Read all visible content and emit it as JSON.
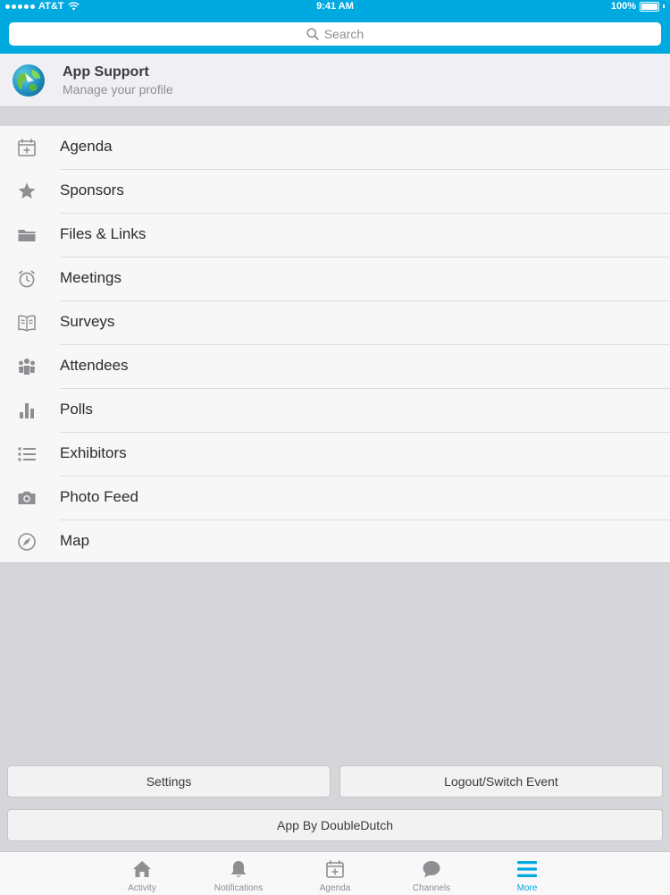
{
  "status_bar": {
    "carrier": "AT&T",
    "time": "9:41 AM",
    "battery": "100%"
  },
  "search": {
    "placeholder": "Search"
  },
  "profile": {
    "title": "App Support",
    "subtitle": "Manage your profile"
  },
  "menu": {
    "items": [
      {
        "label": "Agenda",
        "icon": "calendar-icon"
      },
      {
        "label": "Sponsors",
        "icon": "star-icon"
      },
      {
        "label": "Files & Links",
        "icon": "folder-icon"
      },
      {
        "label": "Meetings",
        "icon": "alarm-clock-icon"
      },
      {
        "label": "Surveys",
        "icon": "book-icon"
      },
      {
        "label": "Attendees",
        "icon": "people-icon"
      },
      {
        "label": "Polls",
        "icon": "bar-chart-icon"
      },
      {
        "label": "Exhibitors",
        "icon": "list-icon"
      },
      {
        "label": "Photo Feed",
        "icon": "camera-icon"
      },
      {
        "label": "Map",
        "icon": "compass-icon"
      }
    ]
  },
  "buttons": {
    "settings": "Settings",
    "logout": "Logout/Switch Event",
    "app_by": "App By DoubleDutch"
  },
  "tabs": [
    {
      "label": "Activity",
      "icon": "home-icon"
    },
    {
      "label": "Notifications",
      "icon": "bell-icon"
    },
    {
      "label": "Agenda",
      "icon": "calendar-icon"
    },
    {
      "label": "Channels",
      "icon": "chat-bubble-icon"
    },
    {
      "label": "More",
      "icon": "hamburger-menu-icon",
      "active": true
    }
  ],
  "colors": {
    "accent": "#00a9e0",
    "icon_gray": "#8e8e93",
    "background": "#d6d6da"
  }
}
